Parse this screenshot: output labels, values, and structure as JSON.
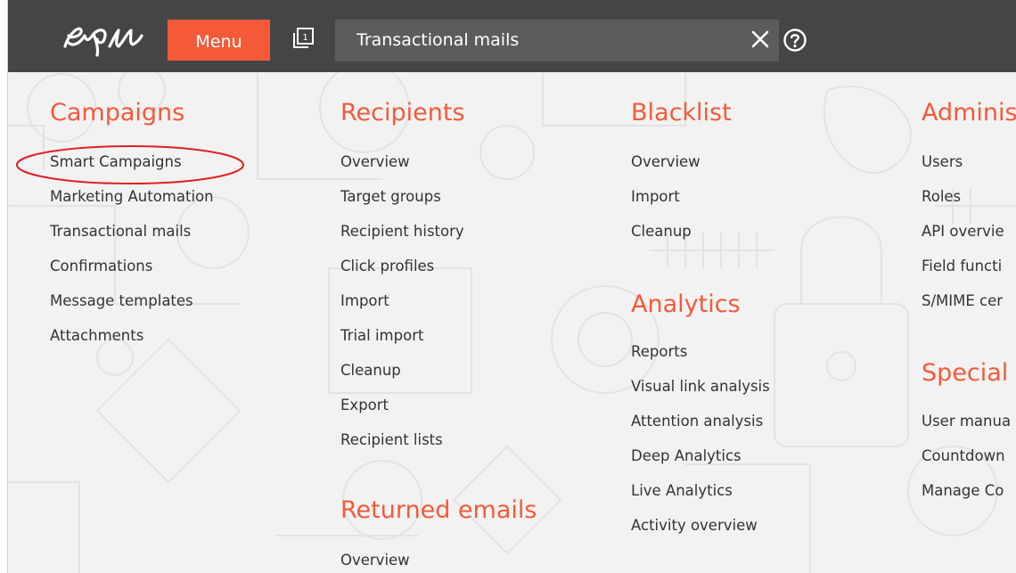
{
  "topbar": {
    "menu_label": "Menu",
    "pages_badge": "1",
    "search_value": "Transactional mails",
    "icons": [
      "epi-logo",
      "pages-icon",
      "close-icon",
      "help-icon"
    ]
  },
  "colors": {
    "accent": "#f45a3a",
    "topbar_bg": "#454545",
    "search_bg": "#5c5c5c",
    "content_bg": "#f2f2f2",
    "text": "#333333",
    "highlight": "#e02020"
  },
  "columns": {
    "campaigns": {
      "heading": "Campaigns",
      "items": [
        "Smart Campaigns",
        "Marketing Automation",
        "Transactional mails",
        "Confirmations",
        "Message templates",
        "Attachments"
      ]
    },
    "recipients": {
      "heading": "Recipients",
      "items": [
        "Overview",
        "Target groups",
        "Recipient history",
        "Click profiles",
        "Import",
        "Trial import",
        "Cleanup",
        "Export",
        "Recipient lists"
      ]
    },
    "returned_emails": {
      "heading": "Returned emails",
      "items": [
        "Overview"
      ]
    },
    "blacklist": {
      "heading": "Blacklist",
      "items": [
        "Overview",
        "Import",
        "Cleanup"
      ]
    },
    "analytics": {
      "heading": "Analytics",
      "items": [
        "Reports",
        "Visual link analysis",
        "Attention analysis",
        "Deep Analytics",
        "Live Analytics",
        "Activity overview"
      ]
    },
    "administration": {
      "heading": "Adminis",
      "items": [
        "Users",
        "Roles",
        "API overvie",
        "Field functi",
        "S/MIME cer"
      ]
    },
    "special": {
      "heading": "Special",
      "items": [
        "User manua",
        "Countdown",
        "Manage Co"
      ]
    }
  }
}
